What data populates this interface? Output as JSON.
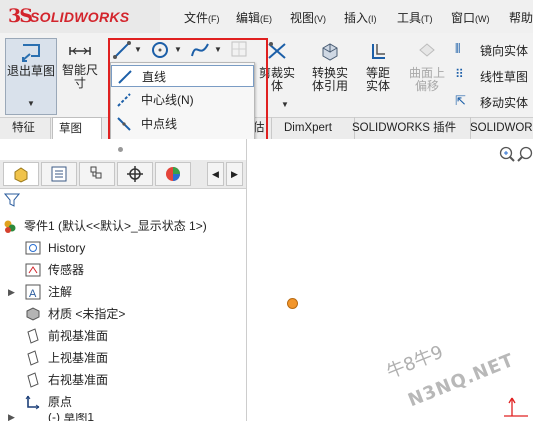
{
  "app": {
    "logo_ds": "3S",
    "logo_text": "SOLIDWORKS"
  },
  "menubar": [
    {
      "label": "文件",
      "key": "(F)"
    },
    {
      "label": "编辑",
      "key": "(E)"
    },
    {
      "label": "视图",
      "key": "(V)"
    },
    {
      "label": "插入",
      "key": "(I)"
    },
    {
      "label": "工具",
      "key": "(T)"
    },
    {
      "label": "窗口",
      "key": "(W)"
    },
    {
      "label": "帮助",
      "key": ""
    }
  ],
  "commands": {
    "exit_sketch": "退出草图",
    "smart_dim": "智能尺寸",
    "trim": "剪裁实体",
    "convert": "转换实体引用",
    "offset": "等距实体",
    "surface_offset": "曲面上偏移",
    "mirror": "镜向实体",
    "linear_pattern": "线性草图",
    "move": "移动实体"
  },
  "dropdown": {
    "items": [
      {
        "label": "直线"
      },
      {
        "label": "中心线(N)"
      },
      {
        "label": "中点线"
      }
    ]
  },
  "tabs": [
    {
      "label": "特征"
    },
    {
      "label": "草图"
    },
    {
      "label": "估"
    },
    {
      "label": "DimXpert"
    },
    {
      "label": "SOLIDWORKS 插件"
    },
    {
      "label": "SOLIDWORK"
    }
  ],
  "tree": {
    "root": "零件1  (默认<<默认>_显示状态 1>)",
    "items": [
      {
        "label": "History",
        "icon": "history-icon"
      },
      {
        "label": "传感器",
        "icon": "sensor-icon"
      },
      {
        "label": "注解",
        "icon": "annotation-icon"
      },
      {
        "label": "材质 <未指定>",
        "icon": "material-icon"
      },
      {
        "label": "前视基准面",
        "icon": "plane-icon"
      },
      {
        "label": "上视基准面",
        "icon": "plane-icon"
      },
      {
        "label": "右视基准面",
        "icon": "plane-icon"
      },
      {
        "label": "原点",
        "icon": "origin-icon"
      },
      {
        "label": "(-) 草图1",
        "icon": "sketch-icon"
      }
    ]
  },
  "watermark": {
    "line1": "牛8牛9",
    "line2": "N3NQ.NET"
  },
  "colors": {
    "brand": "#d3242c",
    "highlight": "#e02020",
    "origin": "#f2952a"
  }
}
